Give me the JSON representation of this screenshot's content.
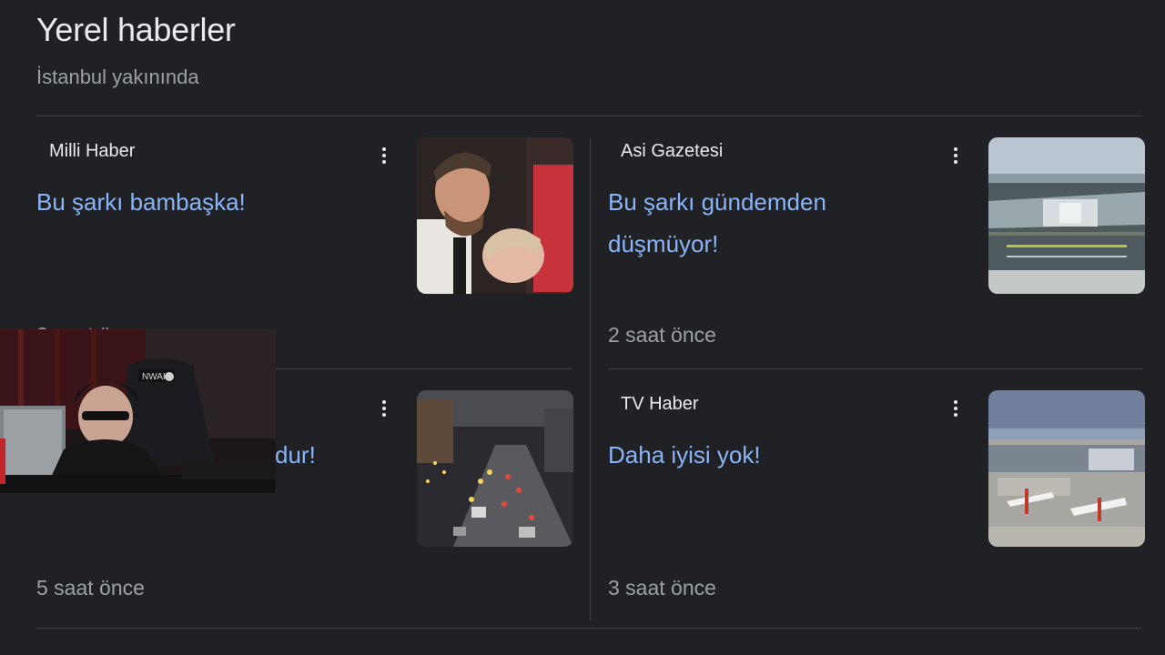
{
  "header": {
    "title": "Yerel haberler",
    "subtitle": "İstanbul yakınında"
  },
  "cards": [
    {
      "source": "Milli Haber",
      "headline": "Bu şarkı bambaşka!",
      "time": "2 saat önce",
      "thumbnail_icon": "news-photo-couple"
    },
    {
      "source": "Asi Gazetesi",
      "headline": "Bu şarkı gündemden düşmüyor!",
      "time": "2 saat önce",
      "thumbnail_icon": "news-photo-airport-aerial"
    },
    {
      "source": "",
      "headline": "dur!",
      "time": "5 saat önce",
      "thumbnail_icon": "news-photo-night-traffic"
    },
    {
      "source": "TV Haber",
      "headline": "Daha iyisi yok!",
      "time": "3 saat önce",
      "thumbnail_icon": "news-photo-airport-terminal"
    }
  ],
  "overlay": {
    "type": "webcam-feed",
    "chair_brand": "NWAH"
  },
  "colors": {
    "background": "#202124",
    "headline_link": "#8ab4f8",
    "muted_text": "#9aa0a6",
    "divider": "#3c4043"
  }
}
